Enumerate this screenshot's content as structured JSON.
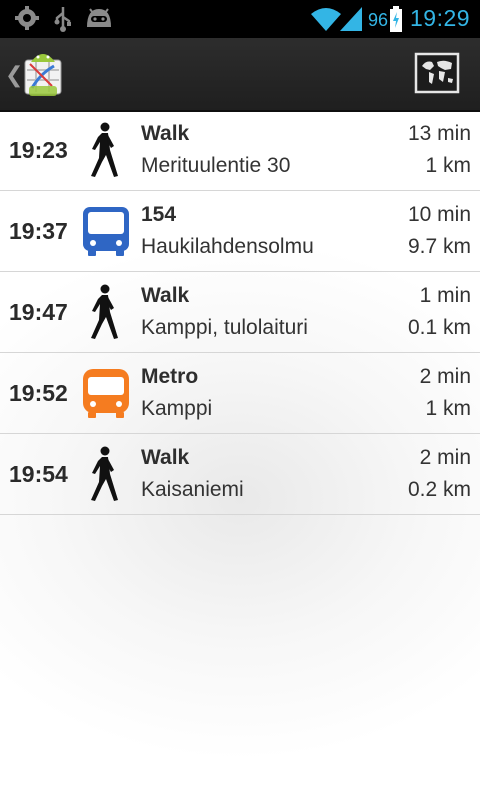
{
  "status_bar": {
    "battery_level": "96",
    "clock": "19:29",
    "accent_color": "#33b5e5",
    "icons": [
      "settings-gear-icon",
      "usb-icon",
      "cyanogen-android-icon",
      "wifi-icon",
      "signal-icon",
      "battery-charging-icon"
    ]
  },
  "action_bar": {
    "up_icon": "chevron-left-icon",
    "app_icon": "android-map-app-icon",
    "map_button_icon": "world-map-icon"
  },
  "legs": [
    {
      "time": "19:23",
      "mode": "walk",
      "mode_icon": "walking-person-icon",
      "title": "Walk",
      "place": "Merituulentie 30",
      "duration": "13 min",
      "distance": "1 km"
    },
    {
      "time": "19:37",
      "mode": "bus",
      "mode_icon": "bus-icon",
      "title": "154",
      "place": "Haukilahdensolmu",
      "duration": "10 min",
      "distance": "9.7 km",
      "color": "#2f66c4"
    },
    {
      "time": "19:47",
      "mode": "walk",
      "mode_icon": "walking-person-icon",
      "title": "Walk",
      "place": "Kamppi, tulolaituri",
      "duration": "1 min",
      "distance": "0.1 km"
    },
    {
      "time": "19:52",
      "mode": "metro",
      "mode_icon": "metro-icon",
      "title": "Metro",
      "place": "Kamppi",
      "duration": "2 min",
      "distance": "1 km",
      "color": "#f57c20"
    },
    {
      "time": "19:54",
      "mode": "walk",
      "mode_icon": "walking-person-icon",
      "title": "Walk",
      "place": "Kaisaniemi",
      "duration": "2 min",
      "distance": "0.2 km"
    }
  ]
}
